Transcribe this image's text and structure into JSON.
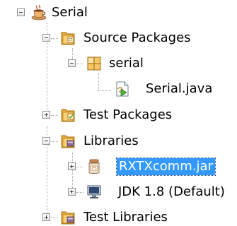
{
  "tree": {
    "project": {
      "label": "Serial",
      "expanded": true,
      "icon": "coffee-cup-icon"
    },
    "source_packages": {
      "label": "Source Packages",
      "expanded": true,
      "icon": "source-folder-icon"
    },
    "package_serial": {
      "label": "serial",
      "expanded": true,
      "icon": "package-icon"
    },
    "file_serial_java": {
      "label": "Serial.java",
      "icon": "java-runnable-file-icon"
    },
    "test_packages": {
      "label": "Test Packages",
      "expanded": false,
      "icon": "test-folder-icon"
    },
    "libraries": {
      "label": "Libraries",
      "expanded": true,
      "icon": "libraries-folder-icon"
    },
    "lib_rxtx": {
      "label": "RXTXcomm.jar",
      "expanded": false,
      "selected": true,
      "icon": "jar-icon"
    },
    "lib_jdk": {
      "label": "JDK 1.8 (Default)",
      "expanded": false,
      "icon": "jdk-monitor-icon"
    },
    "test_libraries": {
      "label": "Test Libraries",
      "expanded": false,
      "icon": "test-libraries-folder-icon"
    }
  },
  "colors": {
    "selection": "#3399ff",
    "folder": "#e8b04a",
    "package": "#f0c060"
  }
}
